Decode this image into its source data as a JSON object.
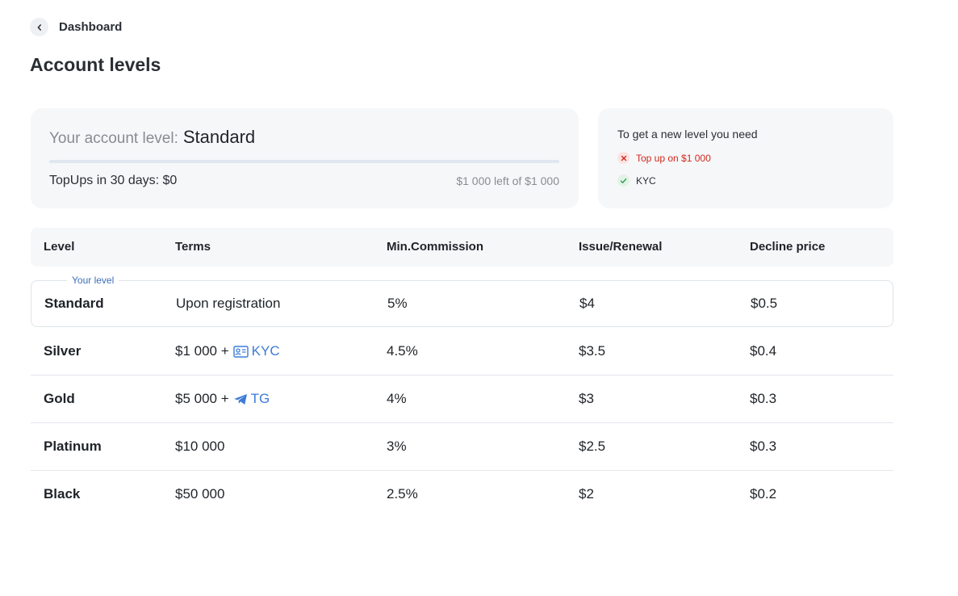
{
  "nav": {
    "back_label": "Dashboard"
  },
  "page_title": "Account levels",
  "level_card": {
    "prefix": "Your account level:",
    "level": "Standard",
    "progress_fraction": 0,
    "topups_text": "TopUps in 30 days: $0",
    "left_text": "$1 000 left of $1 000"
  },
  "requirements": {
    "title": "To get a new level you need",
    "items": [
      {
        "label": "Top up on $1 000",
        "status": "fail"
      },
      {
        "label": "KYC",
        "status": "done"
      }
    ]
  },
  "table": {
    "headers": [
      "Level",
      "Terms",
      "Min.Commission",
      "Issue/Renewal",
      "Decline price"
    ],
    "your_level_label": "Your level",
    "rows": [
      {
        "level": "Standard",
        "terms": "Upon registration",
        "terms_link": "",
        "terms_icon": "",
        "commission": "5%",
        "issue": "$4",
        "decline": "$0.5",
        "current": true
      },
      {
        "level": "Silver",
        "terms": "$1 000 +",
        "terms_link": "KYC",
        "terms_icon": "id-card-icon",
        "commission": "4.5%",
        "issue": "$3.5",
        "decline": "$0.4",
        "current": false
      },
      {
        "level": "Gold",
        "terms": "$5 000 +",
        "terms_link": "TG",
        "terms_icon": "telegram-icon",
        "commission": "4%",
        "issue": "$3",
        "decline": "$0.3",
        "current": false
      },
      {
        "level": "Platinum",
        "terms": "$10 000",
        "terms_link": "",
        "terms_icon": "",
        "commission": "3%",
        "issue": "$2.5",
        "decline": "$0.3",
        "current": false
      },
      {
        "level": "Black",
        "terms": "$50 000",
        "terms_link": "",
        "terms_icon": "",
        "commission": "2.5%",
        "issue": "$2",
        "decline": "$0.2",
        "current": false
      }
    ]
  },
  "colors": {
    "accent": "#3d7bd8",
    "error": "#d0281b",
    "success": "#2e9b4f",
    "card_bg": "#f6f7f9"
  }
}
